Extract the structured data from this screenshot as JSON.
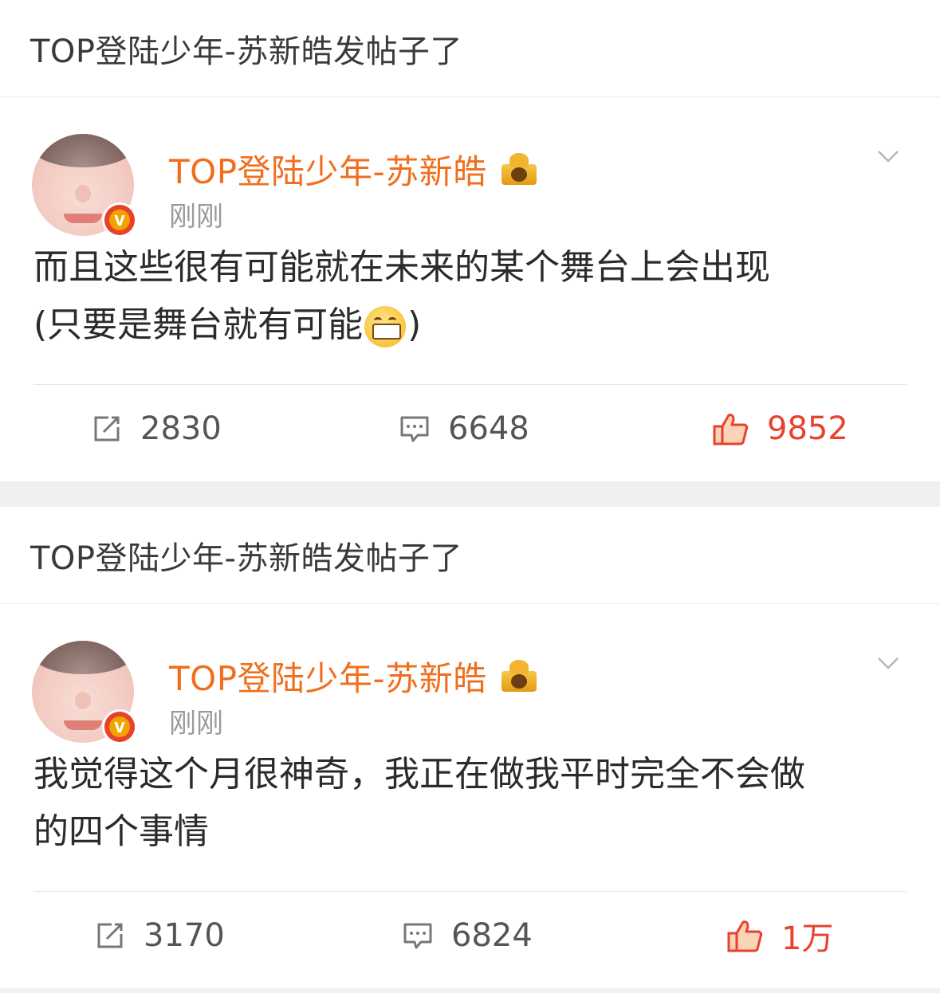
{
  "posts": [
    {
      "notice": "TOP登陆少年-苏新皓发帖子了",
      "username": "TOP登陆少年-苏新皓",
      "time": "刚刚",
      "text_line1": "而且这些很有可能就在未来的某个舞台上会出现",
      "text_line2_before": "(只要是舞台就有可能",
      "text_line2_after": ")",
      "emoji": "grin-emoji",
      "repost_count": "2830",
      "comment_count": "6648",
      "like_count": "9852"
    },
    {
      "notice": "TOP登陆少年-苏新皓发帖子了",
      "username": "TOP登陆少年-苏新皓",
      "time": "刚刚",
      "text_line1": "我觉得这个月很神奇，我正在做我平时完全不会做",
      "text_line2": "的四个事情",
      "repost_count": "3170",
      "comment_count": "6824",
      "like_count": "1万"
    }
  ],
  "badge_letter": "v",
  "colors": {
    "username": "#f06f1d",
    "like": "#e8412d",
    "time": "#9a9a9a"
  }
}
